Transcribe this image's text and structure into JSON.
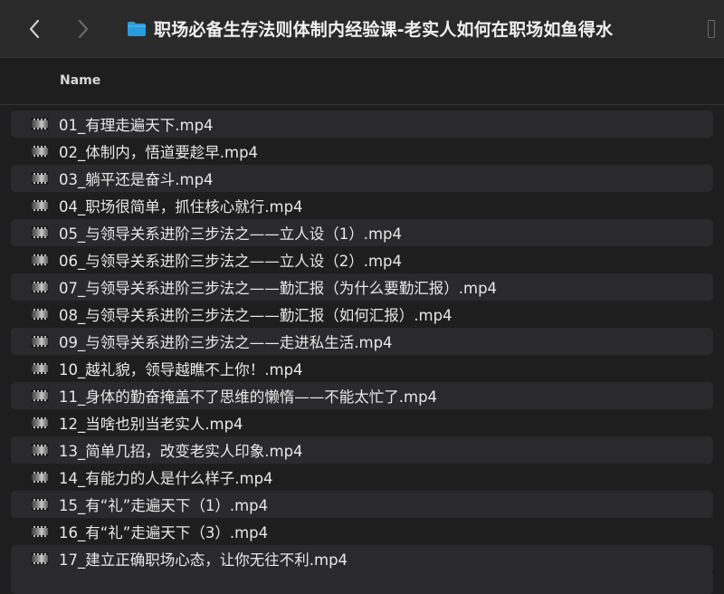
{
  "window": {
    "title": "职场必备生存法则体制内经验课-老实人如何在职场如鱼得水"
  },
  "toolbar": {
    "back_icon": "chevron-left-icon",
    "forward_icon": "chevron-right-icon",
    "folder_icon": "folder-icon",
    "folder_color": "#2a9bdc"
  },
  "header": {
    "name_column": "Name"
  },
  "files": [
    {
      "name": "01_有理走遍天下.mp4"
    },
    {
      "name": "02_体制内，悟道要趁早.mp4"
    },
    {
      "name": "03_躺平还是奋斗.mp4"
    },
    {
      "name": "04_职场很简单，抓住核心就行.mp4"
    },
    {
      "name": "05_与领导关系进阶三步法之——立人设（1）.mp4"
    },
    {
      "name": "06_与领导关系进阶三步法之——立人设（2）.mp4"
    },
    {
      "name": "07_与领导关系进阶三步法之——勤汇报（为什么要勤汇报）.mp4"
    },
    {
      "name": "08_与领导关系进阶三步法之——勤汇报（如何汇报）.mp4"
    },
    {
      "name": "09_与领导关系进阶三步法之——走进私生活.mp4"
    },
    {
      "name": "10_越礼貌，领导越瞧不上你！.mp4"
    },
    {
      "name": "11_身体的勤奋掩盖不了思维的懒惰——不能太忙了.mp4"
    },
    {
      "name": "12_当啥也别当老实人.mp4"
    },
    {
      "name": "13_简单几招，改变老实人印象.mp4"
    },
    {
      "name": "14_有能力的人是什么样子.mp4"
    },
    {
      "name": "15_有“礼”走遍天下（1）.mp4"
    },
    {
      "name": "16_有“礼”走遍天下（3）.mp4"
    },
    {
      "name": "17_建立正确职场心态，让你无往不利.mp4"
    }
  ]
}
